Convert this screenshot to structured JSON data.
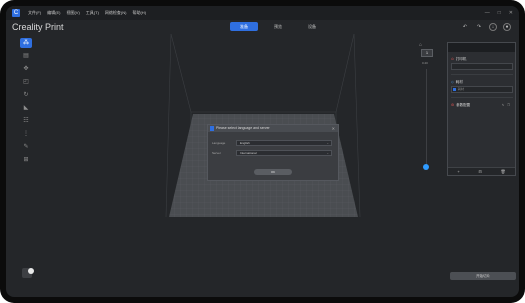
{
  "menubar": {
    "logo": "C",
    "items": [
      "文件(F)",
      "编辑(E)",
      "视图(V)",
      "工具(T)",
      "网络检查(N)",
      "帮助(H)"
    ],
    "window_controls": [
      "—",
      "□",
      "✕"
    ]
  },
  "header": {
    "app_title": "Creality Print",
    "tabs": [
      {
        "label": "准备",
        "active": true
      },
      {
        "label": "预览",
        "active": false
      },
      {
        "label": "设备",
        "active": false
      }
    ],
    "icons": [
      "undo-icon",
      "redo-icon",
      "download-icon",
      "user-icon"
    ]
  },
  "left_toolbar": {
    "buttons": [
      {
        "icon": "objects-icon",
        "glyph": "⁂",
        "active": true
      },
      {
        "icon": "import-icon",
        "glyph": "▤",
        "active": false
      },
      {
        "icon": "move-icon",
        "glyph": "✥",
        "active": false
      },
      {
        "icon": "scale-icon",
        "glyph": "◰",
        "active": false
      },
      {
        "icon": "rotate-icon",
        "glyph": "↻",
        "active": false
      },
      {
        "icon": "lay-flat-icon",
        "glyph": "◣",
        "active": false
      },
      {
        "icon": "cut-icon",
        "glyph": "☷",
        "active": false
      },
      {
        "icon": "support-icon",
        "glyph": "⋮",
        "active": false
      },
      {
        "icon": "paint-icon",
        "glyph": "✎",
        "active": false
      },
      {
        "icon": "arrange-icon",
        "glyph": "⊞",
        "active": false
      }
    ]
  },
  "dialog": {
    "title": "Please select language and server",
    "close": "✕",
    "language_label": "Language",
    "language_value": "English",
    "server_label": "Server",
    "server_value": "International",
    "ok_label": "OK",
    "chevron": "⌄"
  },
  "layer_slider": {
    "top_value": "1",
    "label": "0.20",
    "home_glyph": "⌂"
  },
  "right_panel": {
    "printer_title": "打印机",
    "material_title": "耗材",
    "material_field": "耗材",
    "process_title": "参数配置",
    "bottom_buttons": [
      "+",
      "⊟",
      "🗑"
    ]
  },
  "slice_button": "开始切片",
  "colors": {
    "accent": "#2f6fe0",
    "background": "#242629",
    "slider_knob": "#2f9bff"
  }
}
